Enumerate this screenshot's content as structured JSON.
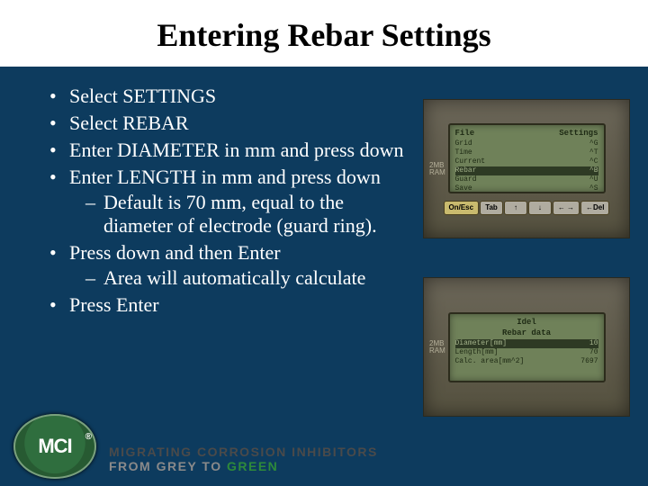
{
  "title": "Entering Rebar Settings",
  "bullets": {
    "b1": "Select SETTINGS",
    "b2": "Select REBAR",
    "b3": "Enter DIAMETER in mm and press down",
    "b4": "Enter LENGTH in mm and press down",
    "b4s1": "Default is 70 mm, equal to the diameter of electrode (guard ring).",
    "b5": "Press down and then Enter",
    "b5s1": "Area will automatically calculate",
    "b6": "Press Enter"
  },
  "device_top": {
    "ram": "2MB RAM",
    "header_left": "File",
    "header_right": "Settings",
    "rows": [
      {
        "l": "Grid",
        "r": "^G"
      },
      {
        "l": "Time",
        "r": "^T"
      },
      {
        "l": "Current",
        "r": "^C"
      },
      {
        "l": "Rebar",
        "r": "^B"
      },
      {
        "l": "Guard",
        "r": "^U"
      },
      {
        "l": "Save",
        "r": "^S"
      }
    ],
    "keys": {
      "k1": "On/Esc",
      "k2": "Tab",
      "k3": "↑",
      "k4": "↓",
      "k5": "← →",
      "k6": "←Del"
    }
  },
  "device_bottom": {
    "ram": "2MB RAM",
    "header_center": "Idel",
    "subheader": "Rebar data",
    "rows": [
      {
        "l": "Diameter[mm]",
        "r": "10"
      },
      {
        "l": "Length[mm]",
        "r": "70"
      },
      {
        "l": "Calc. area[mm^2]",
        "r": "7697"
      }
    ]
  },
  "footer": {
    "badge": "MCI",
    "reg": "®",
    "line1": "MIGRATING CORROSION INHIBITORS",
    "line2a": "FROM GREY TO ",
    "line2b": "GREEN"
  }
}
